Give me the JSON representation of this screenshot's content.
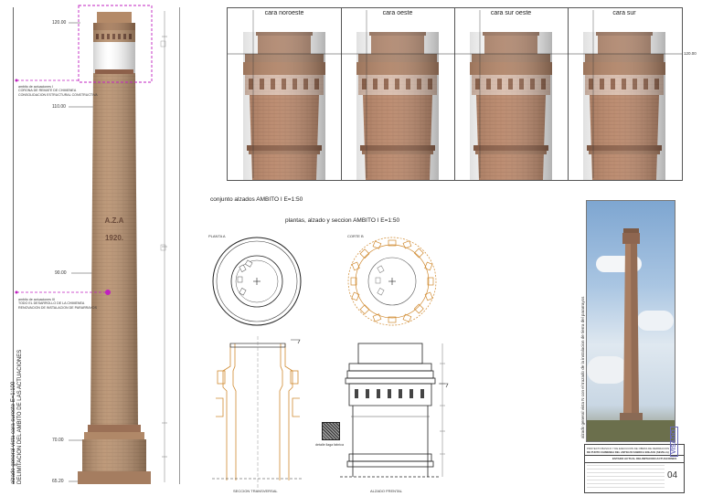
{
  "levels": {
    "l1": "120.00",
    "l2": "110.00",
    "l3": "90.00",
    "l4": "70.00",
    "l5": "65.20",
    "right_top": "120.00"
  },
  "chimney_inscription": {
    "line1": "A.Z.A",
    "line2": "1920."
  },
  "notes": {
    "upper": {
      "title": "ambito de actuaciones I",
      "line1": "CORONA DE REMATE DE CHIMENEA",
      "line2": "CONSOLIDACION ESTRUCTURAL    CONSTRUCTIVA"
    },
    "lower": {
      "title": "ambito de actuaciones III",
      "line1": "TODO EL DESARROLLO DE LA CHIMENEA",
      "line2": "RENOVACION DE INSTALACION DE PARARRAYOS"
    }
  },
  "vertical_title": {
    "line1": "alzado general   vista cara sureste   E=1:100",
    "line2": "DELIMITACION DEL AMBITO DE LAS ACTUACIONES"
  },
  "faces": [
    "cara noroeste",
    "cara oeste",
    "cara sur oeste",
    "cara sur"
  ],
  "headings": {
    "conjunto": "conjunto alzados   AMBITO I    E=1:50",
    "plantas": "plantas, alzado y seccion   AMBITO I    E=1:50"
  },
  "drawing_labels": {
    "planta": "PLANTA A",
    "corte": "CORTE B",
    "seccion": "SECCION TRANSVERSAL",
    "alzado": "ALZADO FRENTAL",
    "detalle": "detalle llaga fabrica"
  },
  "photo_caption": "alzado general   vista N   con el trazado de la instalacion de tierra del pararrayos",
  "title_block": {
    "project": "PROYECTO BASICO Y DE EJECUCION DE OBRAS DE REPARACION",
    "project2": "DE PUNTO CHIMENEA DEL ANTIGUO FABRICA ENLACE (SEVILLA)",
    "plan_title": "ESTADO ACTUAL  DELIMITACION ACTUACIONES",
    "plan_number": "04",
    "stamp": "VISADO"
  },
  "colors": {
    "brick": "#b89070",
    "brick_dark": "#8a5e44",
    "magenta": "#c020c0",
    "line_orange": "#d08a30"
  }
}
